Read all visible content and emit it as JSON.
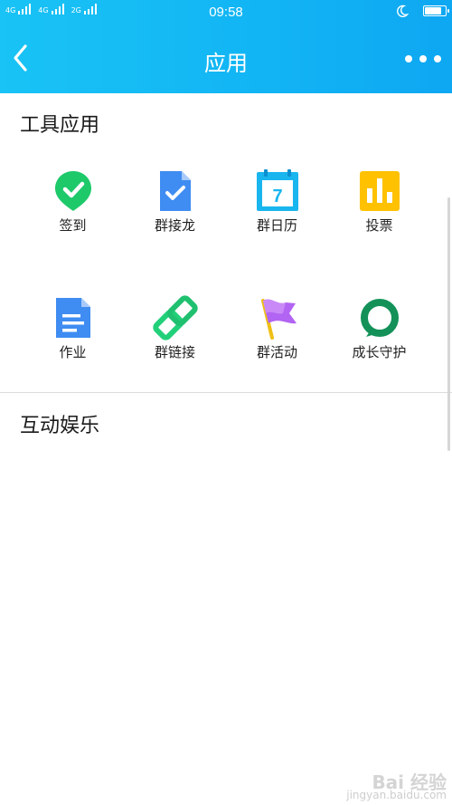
{
  "status_bar": {
    "network_1": "4G",
    "network_2": "4G",
    "network_3": "2G",
    "time": "09:58",
    "battery_percent": 85
  },
  "header": {
    "title": "应用"
  },
  "sections": {
    "tools": {
      "title": "工具应用",
      "apps": [
        {
          "label": "签到",
          "icon": "checkin-pin-icon",
          "color": "#1ec96a"
        },
        {
          "label": "群接龙",
          "icon": "solitaire-doc-icon",
          "color": "#3f8cf2"
        },
        {
          "label": "群日历",
          "icon": "calendar-icon",
          "color": "#19b5ef"
        },
        {
          "label": "投票",
          "icon": "vote-chart-icon",
          "color": "#ffc100"
        },
        {
          "label": "作业",
          "icon": "homework-doc-icon",
          "color": "#3f8cf2"
        },
        {
          "label": "群链接",
          "icon": "link-icon",
          "color": "#22d07a"
        },
        {
          "label": "群活动",
          "icon": "activity-flag-icon",
          "color": "#b264f2"
        },
        {
          "label": "成长守护",
          "icon": "growth-ring-icon",
          "color": "#139158"
        }
      ],
      "calendar_day": "7"
    },
    "entertainment": {
      "title": "互动娱乐"
    }
  },
  "watermark": {
    "brand": "Bai 经验",
    "url": "jingyan.baidu.com"
  }
}
